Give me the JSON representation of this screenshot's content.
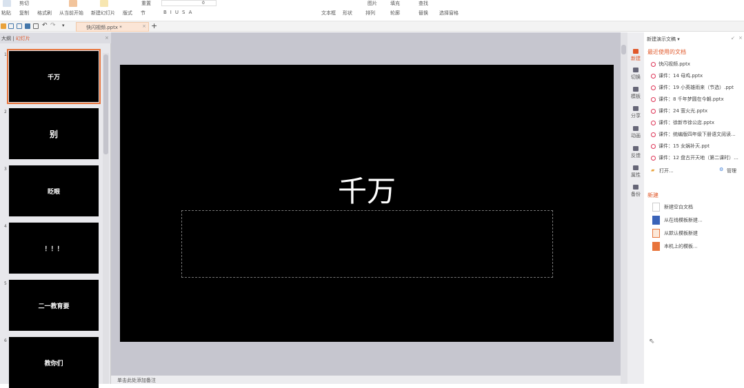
{
  "ribbon": {
    "paste": "粘贴",
    "copy": "复制",
    "format_painter": "格式刷",
    "cut": "剪切",
    "from_current": "从当前开始",
    "new_slide": "新建幻灯片",
    "layout": "版式",
    "section": "节",
    "reset": "重置",
    "font_size": "0",
    "text_box": "文本框",
    "shape": "形状",
    "arrange": "排列",
    "picture": "图片",
    "fill": "填充",
    "outline": "轮廓",
    "find": "查找",
    "replace": "替换",
    "select_pane": "选择窗格"
  },
  "tabbar": {
    "doc_tab": "快闪视频.pptx *",
    "close": "×",
    "add": "+"
  },
  "left_panel": {
    "tab_outline": "大纲",
    "tab_slides": "幻灯片",
    "close": "×",
    "slides": [
      {
        "num": "1",
        "text": "千万"
      },
      {
        "num": "2",
        "text": "别"
      },
      {
        "num": "3",
        "text": "眨眼"
      },
      {
        "num": "4",
        "text": "！！！"
      },
      {
        "num": "5",
        "text": "二一教育要"
      },
      {
        "num": "6",
        "text": "教你们"
      }
    ]
  },
  "slide": {
    "title": "千万"
  },
  "notes": {
    "placeholder": "单击此处添加备注"
  },
  "side_icons": [
    "新建",
    "切换",
    "模板",
    "分享",
    "动画",
    "反馈",
    "属性",
    "备份"
  ],
  "pane": {
    "title": "新建演示文稿 ▾",
    "recent_heading": "最近使用的文档",
    "recent": [
      "快闪视频.pptx",
      "课件：14 母鸡.pptx",
      "课件：19 小英雄雨来（节选）.ppt",
      "课件：8 千年梦圆在今朝.pptx",
      "课件：24 萤火光.pptx",
      "课件：徐新市徐公店.pptx",
      "课件：统编版四年级下册语文阅读...",
      "课件：15 女娲补天.ppt",
      "课件：12 盘古开天地（第二课时）..."
    ],
    "open": "打开...",
    "manage": "管理",
    "new_heading": "新建",
    "new_items": [
      "新建空白文档",
      "从在线模板新建...",
      "从默认模板新建",
      "本机上的模板..."
    ]
  },
  "colors": {
    "accent": "#e0582a"
  }
}
